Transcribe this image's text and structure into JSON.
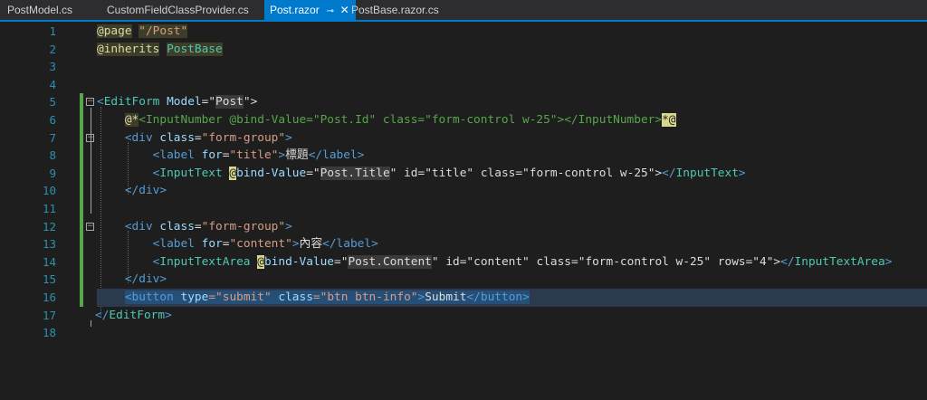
{
  "tabs": [
    {
      "label": "PostModel.cs",
      "active": false
    },
    {
      "label": "CustomFieldClassProvider.cs",
      "active": false
    },
    {
      "label": "Post.razor",
      "active": true
    },
    {
      "label": "PostBase.razor.cs",
      "active": false
    }
  ],
  "tab_icons": {
    "pin": "pin-icon",
    "close": "close-icon"
  },
  "line_numbers": [
    "1",
    "2",
    "3",
    "4",
    "5",
    "6",
    "7",
    "8",
    "9",
    "10",
    "11",
    "12",
    "13",
    "14",
    "15",
    "16",
    "17",
    "18"
  ],
  "code": {
    "l1": {
      "dir": "@page",
      "sp": " ",
      "val": "\"/Post\""
    },
    "l2": {
      "dir": "@inherits",
      "sp": " ",
      "val": "PostBase"
    },
    "l5": {
      "open": "<",
      "tag": "EditForm",
      "sp": " ",
      "attr": "Model",
      "eq": "=\"",
      "val": "Post",
      "close": "\">"
    },
    "l6": {
      "indent": "    ",
      "start": "@*",
      "body": "<InputNumber @bind-Value=\"Post.Id\" class=\"form-control w-25\"></InputNumber>",
      "end": "*@"
    },
    "l7": {
      "indent": "    ",
      "open": "<",
      "tag": "div",
      "sp": " ",
      "attr": "class",
      "eq": "=",
      "val": "\"form-group\"",
      "close": ">"
    },
    "l8": {
      "indent": "        ",
      "open": "<",
      "tag": "label",
      "sp": " ",
      "attr": "for",
      "eq": "=",
      "val": "\"title\"",
      "gt": ">",
      "text": "標題",
      "end": "</",
      "endtag": "label",
      "endgt": ">"
    },
    "l9": {
      "indent": "        ",
      "open": "<",
      "tag": "InputText",
      "sp": " ",
      "at": "@",
      "attr": "bind-Value",
      "eq": "=\"",
      "val": "Post.Title",
      "q": "\"",
      "rest": " id=\"title\" class=\"form-control w-25\">",
      "end": "</",
      "endtag": "InputText",
      "endgt": ">"
    },
    "l10": {
      "indent": "    ",
      "end": "</",
      "tag": "div",
      "gt": ">"
    },
    "l12": {
      "indent": "    ",
      "open": "<",
      "tag": "div",
      "sp": " ",
      "attr": "class",
      "eq": "=",
      "val": "\"form-group\"",
      "close": ">"
    },
    "l13": {
      "indent": "        ",
      "open": "<",
      "tag": "label",
      "sp": " ",
      "attr": "for",
      "eq": "=",
      "val": "\"content\"",
      "gt": ">",
      "text": "內容",
      "end": "</",
      "endtag": "label",
      "endgt": ">"
    },
    "l14": {
      "indent": "        ",
      "open": "<",
      "tag": "InputTextArea",
      "sp": " ",
      "at": "@",
      "attr": "bind-Value",
      "eq": "=\"",
      "val": "Post.Content",
      "q": "\"",
      "rest": " id=\"content\" class=\"form-control w-25\" rows=\"4\">",
      "end": "</",
      "endtag": "InputTextArea",
      "endgt": ">"
    },
    "l15": {
      "indent": "    ",
      "end": "</",
      "tag": "div",
      "gt": ">"
    },
    "l16": {
      "indent": "    ",
      "open": "<",
      "tag": "button",
      "sp": " ",
      "attr1": "type",
      "val1": "=\"submit\"",
      "sp2": " ",
      "attr2": "class",
      "val2": "=\"btn btn-info\"",
      "gt": ">",
      "text": "Submit",
      "end": "</",
      "endtag": "button",
      "endgt": ">"
    },
    "l17": {
      "end": "</",
      "tag": "EditForm",
      "gt": ">"
    }
  },
  "colors": {
    "tag": "#569cd6",
    "component": "#4ec9b0",
    "attribute": "#9cdcfe",
    "string": "#d69d85",
    "comment": "#57a64a",
    "line_number": "#2b91af",
    "active_tab": "#007acc"
  }
}
